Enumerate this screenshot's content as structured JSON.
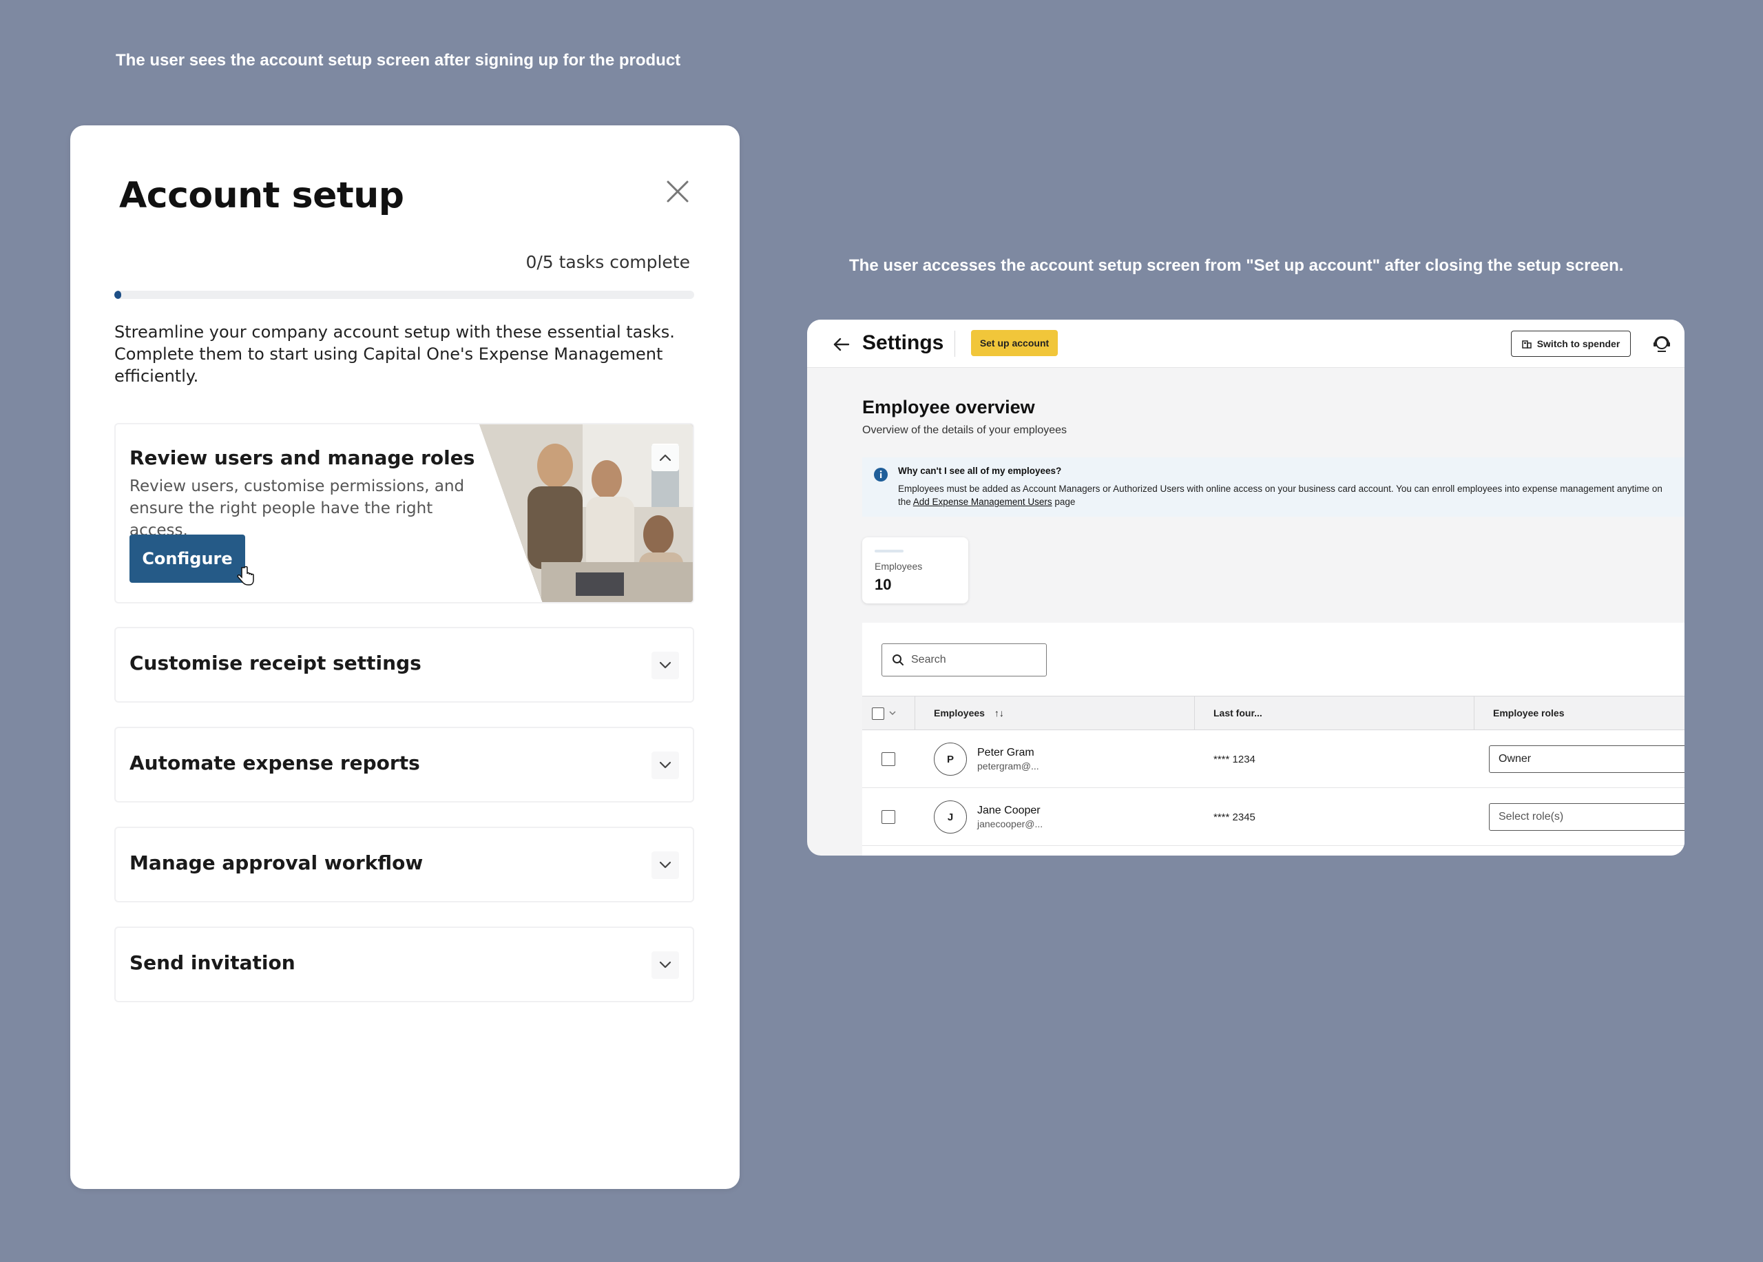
{
  "captions": {
    "left": "The user sees the account setup screen after signing up for the product",
    "right": "The user accesses the account setup screen from \"Set up account\" after closing the setup screen."
  },
  "setup": {
    "title": "Account setup",
    "progress_text": "0/5 tasks complete",
    "progress_fraction": 0.0,
    "description": "Streamline your company account setup with these essential tasks. Complete them to start using Capital One's Expense Management efficiently.",
    "active_task": {
      "title": "Review users and manage roles",
      "description": "Review users, customise permissions, and ensure the right people have the right access.",
      "button_label": "Configure",
      "expanded": true
    },
    "tasks": [
      {
        "label": "Customise receipt settings"
      },
      {
        "label": "Automate expense reports"
      },
      {
        "label": "Manage approval workflow"
      },
      {
        "label": "Send invitation"
      }
    ],
    "accent_color": "#255a87"
  },
  "settings": {
    "title": "Settings",
    "setup_button_label": "Set up account",
    "setup_button_color": "#f1c63a",
    "switch_button_label": "Switch to spender",
    "overview_title": "Employee overview",
    "overview_subtitle": "Overview of the details of your employees",
    "info": {
      "heading": "Why can't I see all of my employees?",
      "body_prefix": "Employees must be added as Account Managers or Authorized Users with online access on your business card account. You can enroll employees into expense management anytime on the ",
      "link_text": "Add Expense Management Users",
      "body_suffix": " page"
    },
    "stat": {
      "label": "Employees",
      "value": "10"
    },
    "search": {
      "placeholder": "Search"
    },
    "columns": {
      "employees": "Employees",
      "sort_glyph": "↑↓",
      "last_four": "Last four...",
      "roles": "Employee roles"
    },
    "rows": [
      {
        "initial": "P",
        "name": "Peter Gram",
        "email": "petergram@...",
        "last_four": "**** 1234",
        "role": "Owner"
      },
      {
        "initial": "J",
        "name": "Jane Cooper",
        "email": "janecooper@...",
        "last_four": "**** 2345",
        "role": "Select role(s)"
      }
    ]
  }
}
